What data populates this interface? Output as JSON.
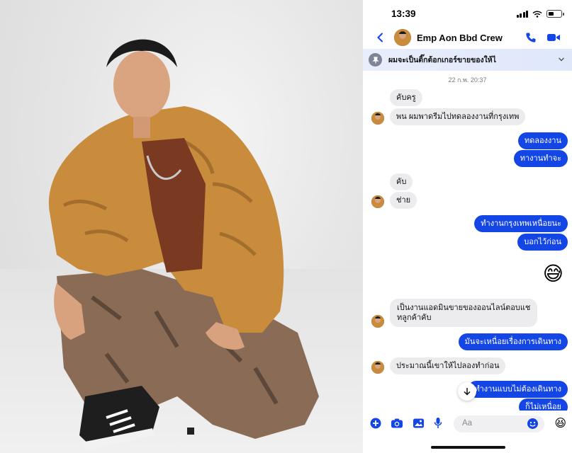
{
  "status_bar": {
    "time": "13:39"
  },
  "header": {
    "contact_name": "Emp Aon Bbd Crew"
  },
  "pinned": {
    "text": "ผมจะเป็นติ๊กต้อกเกอร์ขายของให้ไ"
  },
  "chat": {
    "timestamp": "22 ก.พ. 20:37",
    "messages": [
      {
        "dir": "in",
        "text": "คับครู"
      },
      {
        "dir": "in",
        "text": "พน ผมพาดรีมไปทดลองงานที่กรุงเทพ"
      },
      {
        "dir": "out",
        "text": "ทดลองงาน"
      },
      {
        "dir": "out",
        "text": "ทางานทำจะ"
      },
      {
        "dir": "in",
        "text": "คับ"
      },
      {
        "dir": "in",
        "text": "ช่าย"
      },
      {
        "dir": "out",
        "text": "ทำงานกรุงเทพเหนื่อยนะ"
      },
      {
        "dir": "out",
        "text": "บอกไว้ก่อน"
      },
      {
        "dir": "out",
        "text": "😅"
      },
      {
        "dir": "in",
        "text": "เป็นงานแอดมินขายของออนไลน์ตอบแช"
      },
      {
        "dir": "in",
        "text": "ทลูกค้าคับ"
      },
      {
        "dir": "out",
        "text": "มันจะเหนื่อยเรื่องการเดินทาง"
      },
      {
        "dir": "in",
        "text": "ประมาณนี้เขาให้ไปลองทำก่อน"
      },
      {
        "dir": "out",
        "text": "ทำงานแบบไม่ต้องเดินทาง"
      },
      {
        "dir": "out",
        "text": "ก็ไม่เหนื่อย"
      }
    ]
  },
  "composer": {
    "placeholder": "Aa",
    "like_emoji": "😆"
  },
  "colors": {
    "accent": "#1446e6",
    "incoming_bubble": "#ececef"
  },
  "icons": [
    "back-chevron-icon",
    "phone-icon",
    "video-call-icon",
    "pin-icon",
    "chevron-down-icon",
    "arrow-down-icon",
    "plus-icon",
    "camera-icon",
    "image-icon",
    "microphone-icon",
    "emoji-icon"
  ]
}
